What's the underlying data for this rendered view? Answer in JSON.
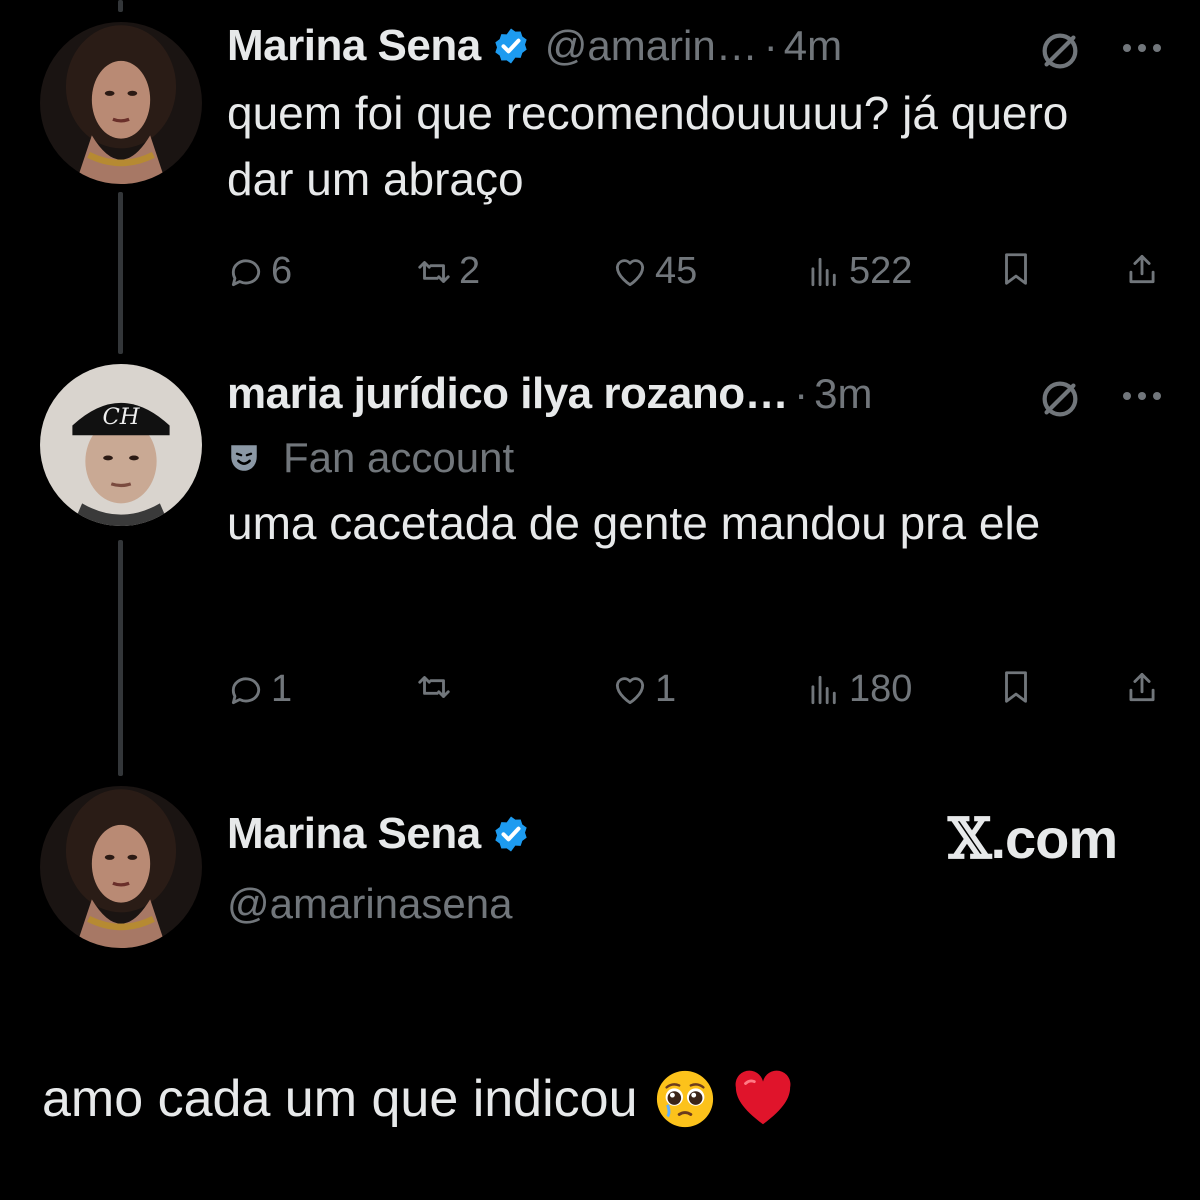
{
  "tweets": [
    {
      "name": "Marina Sena",
      "handle": "@amarin…",
      "separator": "·",
      "time": "4m",
      "text": "quem foi que recomendouuuuu? já quero dar um abraço",
      "actions": {
        "replies": "6",
        "reposts": "2",
        "likes": "45",
        "views": "522"
      }
    },
    {
      "name": "maria jurídico ilya rozano…",
      "separator": "·",
      "time": "3m",
      "label": "Fan account",
      "text": "uma cacetada de gente mandou pra ele",
      "actions": {
        "replies": "1",
        "reposts": "",
        "likes": "1",
        "views": "180"
      }
    }
  ],
  "author_card": {
    "name": "Marina Sena",
    "handle": "@amarinasena",
    "site": ".com"
  },
  "caption": "amo cada um que indicou",
  "icons": {
    "verified": "verified-badge-icon",
    "reply": "reply-icon",
    "repost": "repost-icon",
    "like": "heart-icon",
    "views": "views-icon",
    "bookmark": "bookmark-icon",
    "share": "share-icon",
    "grok": "grok-icon",
    "more": "more-icon",
    "fan": "theater-mask-icon",
    "emoji_1": "pleading-face-emoji",
    "emoji_2": "red-heart-emoji"
  },
  "colors": {
    "background": "#000000",
    "text": "#e7e9ea",
    "secondary": "#71767b",
    "verified": "#1d9bf0",
    "heart": "#e0142b"
  }
}
